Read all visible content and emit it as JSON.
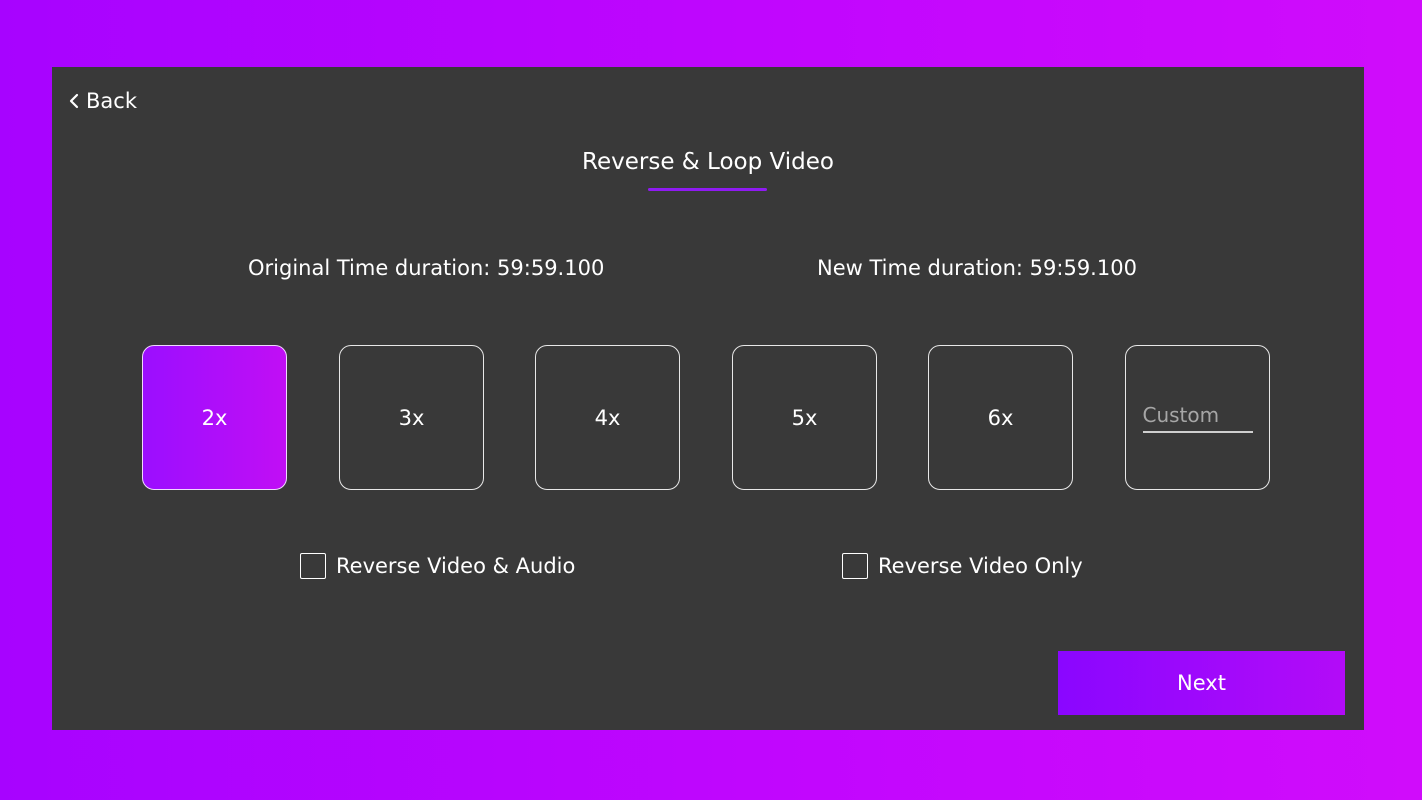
{
  "header": {
    "back_label": "Back",
    "title": "Reverse & Loop Video"
  },
  "durations": {
    "original": "Original Time duration: 59:59.100",
    "new": "New Time duration: 59:59.100"
  },
  "speeds": {
    "options": [
      {
        "label": "2x",
        "selected": true
      },
      {
        "label": "3x",
        "selected": false
      },
      {
        "label": "4x",
        "selected": false
      },
      {
        "label": "5x",
        "selected": false
      },
      {
        "label": "6x",
        "selected": false
      }
    ],
    "custom": {
      "value": "",
      "placeholder": "Custom"
    }
  },
  "options": {
    "reverse_video_audio": {
      "label": "Reverse Video & Audio",
      "checked": false
    },
    "reverse_video_only": {
      "label": "Reverse Video Only",
      "checked": false
    }
  },
  "footer": {
    "next_label": "Next"
  },
  "colors": {
    "accent": "#9b0eff",
    "panel": "#393939",
    "background": "#b905fe"
  },
  "icons": {
    "back": "chevron-left-icon",
    "checkbox": "checkbox-empty"
  }
}
